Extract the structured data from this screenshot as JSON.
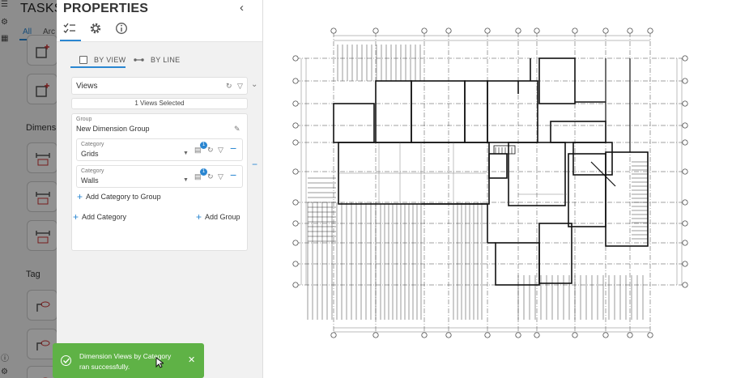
{
  "tasks": {
    "title": "TASKS",
    "tabs": [
      "All",
      "Arc"
    ],
    "sections": [
      "Dimensi",
      "Tag"
    ]
  },
  "properties": {
    "title": "PROPERTIES",
    "collapse_icon": "chevron-left-icon",
    "icon_tabs": [
      "checklist-icon",
      "gear-icon",
      "info-icon"
    ],
    "toggle": {
      "by_view": "BY VIEW",
      "by_line": "BY LINE"
    },
    "views": {
      "label": "Views",
      "selected_text": "1 Views Selected"
    },
    "group": {
      "label": "Group",
      "name": "New Dimension Group",
      "categories": [
        {
          "label": "Category",
          "value": "Grids",
          "badge": "1"
        },
        {
          "label": "Category",
          "value": "Walls",
          "badge": "1"
        }
      ],
      "add_category_to_group": "Add Category to Group"
    },
    "add_category": "Add Category",
    "add_group": "Add Group"
  },
  "toast": {
    "message": "Dimension Views by Category ran successfully.",
    "close_icon": "close-icon",
    "color": "#5fb246"
  },
  "colors": {
    "accent": "#2a86d1"
  }
}
